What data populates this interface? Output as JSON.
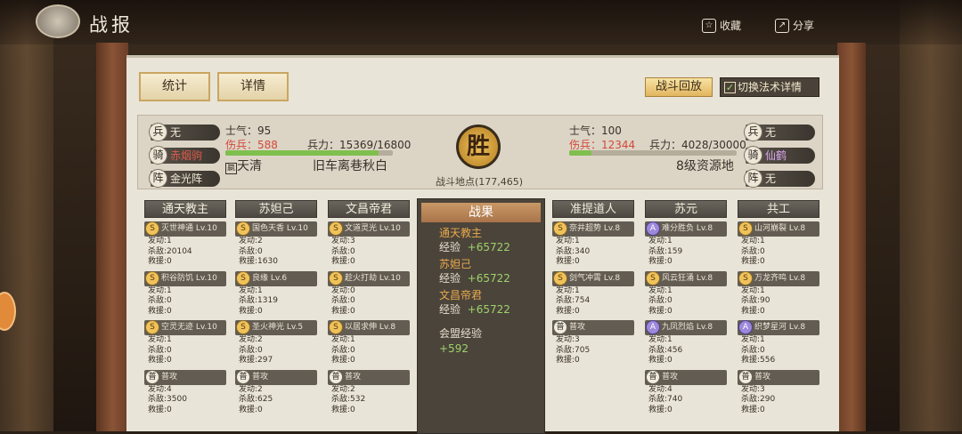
{
  "header": {
    "title": "战报",
    "collect_label": "收藏",
    "share_label": "分享"
  },
  "tabs": {
    "stats": "统计",
    "details": "详情"
  },
  "actions": {
    "replay": "战斗回放",
    "switch": "切换法术详情"
  },
  "left": {
    "morale_label": "士气：",
    "morale": "95",
    "wounded_label": "伤兵：",
    "wounded": "588",
    "troops_label": "兵力：",
    "troops": "15369/16800",
    "troops_ratio": 0.915,
    "bing": "兵",
    "bing_v": "无",
    "qi": "骑",
    "qi_v": "赤烟驹",
    "zhen": "阵",
    "zhen_v": "金光阵",
    "player_badge": "嬴",
    "player": "天清",
    "place": "旧车离巷秋白"
  },
  "right": {
    "morale_label": "士气：",
    "morale": "100",
    "wounded_label": "伤兵：",
    "wounded": "12344",
    "troops_label": "兵力：",
    "troops": "4028/30000",
    "troops_ratio": 0.134,
    "bing": "兵",
    "bing_v": "无",
    "qi": "骑",
    "qi_v": "仙鹤",
    "zhen": "阵",
    "zhen_v": "无",
    "place": "8级资源地"
  },
  "center": {
    "seal": "胜",
    "location": "战斗地点(177,465)"
  },
  "result": {
    "title": "战果",
    "rows": [
      {
        "name": "通天教主",
        "label": "经验",
        "value": "+65722"
      },
      {
        "name": "苏妲己",
        "label": "经验",
        "value": "+65722"
      },
      {
        "name": "文昌帝君",
        "label": "经验",
        "value": "+65722"
      }
    ],
    "league_label": "会盟经验",
    "league_value": "+592"
  },
  "generals": [
    {
      "name": "通天教主",
      "skills": [
        {
          "q": "S",
          "n": "灭世神通 Lv.10",
          "s": [
            "发动:1",
            "杀敌:20104",
            "救援:0"
          ]
        },
        {
          "q": "S",
          "n": "积谷防饥 Lv.10",
          "s": [
            "发动:1",
            "杀敌:0",
            "救援:0"
          ]
        },
        {
          "q": "S",
          "n": "空灵无迹 Lv.10",
          "s": [
            "发动:1",
            "杀敌:0",
            "救援:0"
          ]
        },
        {
          "q": "普",
          "n": "普攻",
          "s": [
            "发动:4",
            "杀敌:3500",
            "救援:0"
          ]
        }
      ]
    },
    {
      "name": "苏妲己",
      "skills": [
        {
          "q": "S",
          "n": "国色天香 Lv.10",
          "s": [
            "发动:2",
            "杀敌:0",
            "救援:1630"
          ]
        },
        {
          "q": "S",
          "n": "良缘 Lv.6",
          "s": [
            "发动:1",
            "杀敌:1319",
            "救援:0"
          ]
        },
        {
          "q": "S",
          "n": "圣火神光 Lv.5",
          "s": [
            "发动:2",
            "杀敌:0",
            "救援:297"
          ]
        },
        {
          "q": "普",
          "n": "普攻",
          "s": [
            "发动:2",
            "杀敌:625",
            "救援:0"
          ]
        }
      ]
    },
    {
      "name": "文昌帝君",
      "skills": [
        {
          "q": "S",
          "n": "文道灵光 Lv.10",
          "s": [
            "发动:3",
            "杀敌:0",
            "救援:0"
          ]
        },
        {
          "q": "S",
          "n": "趁火打劫 Lv.10",
          "s": [
            "发动:0",
            "杀敌:0",
            "救援:0"
          ]
        },
        {
          "q": "S",
          "n": "以居求伸 Lv.8",
          "s": [
            "发动:1",
            "杀敌:0",
            "救援:0"
          ]
        },
        {
          "q": "普",
          "n": "普攻",
          "s": [
            "发动:2",
            "杀敌:532",
            "救援:0"
          ]
        }
      ]
    },
    {
      "name": "准提道人",
      "skills": [
        {
          "q": "S",
          "n": "奈井超势 Lv.8",
          "s": [
            "发动:1",
            "杀敌:340",
            "救援:0"
          ]
        },
        {
          "q": "S",
          "n": "剑气冲霄 Lv.8",
          "s": [
            "发动:1",
            "杀敌:754",
            "救援:0"
          ]
        },
        {
          "q": "普",
          "n": "普攻",
          "s": [
            "发动:3",
            "杀敌:705",
            "救援:0"
          ]
        }
      ]
    },
    {
      "name": "苏元",
      "skills": [
        {
          "q": "A",
          "n": "难分胜负 Lv.8",
          "s": [
            "发动:1",
            "杀敌:159",
            "救援:0"
          ]
        },
        {
          "q": "S",
          "n": "风云狂涌 Lv.8",
          "s": [
            "发动:1",
            "杀敌:0",
            "救援:0"
          ]
        },
        {
          "q": "A",
          "n": "九凤烈焰 Lv.8",
          "s": [
            "发动:1",
            "杀敌:456",
            "救援:0"
          ]
        },
        {
          "q": "普",
          "n": "普攻",
          "s": [
            "发动:4",
            "杀敌:740",
            "救援:0"
          ]
        }
      ]
    },
    {
      "name": "共工",
      "skills": [
        {
          "q": "S",
          "n": "山河崩裂 Lv.8",
          "s": [
            "发动:1",
            "杀敌:0",
            "救援:0"
          ]
        },
        {
          "q": "S",
          "n": "万龙齐鸣 Lv.8",
          "s": [
            "发动:1",
            "杀敌:90",
            "救援:0"
          ]
        },
        {
          "q": "A",
          "n": "织梦星河 Lv.8",
          "s": [
            "发动:1",
            "杀敌:0",
            "救援:556"
          ]
        },
        {
          "q": "普",
          "n": "普攻",
          "s": [
            "发动:3",
            "杀敌:290",
            "救援:0"
          ]
        }
      ]
    }
  ],
  "colors": {
    "accent": "#e2b55e",
    "win": "#f0c25b",
    "hp": "#7fbf4e",
    "wounded": "#d2483a"
  }
}
